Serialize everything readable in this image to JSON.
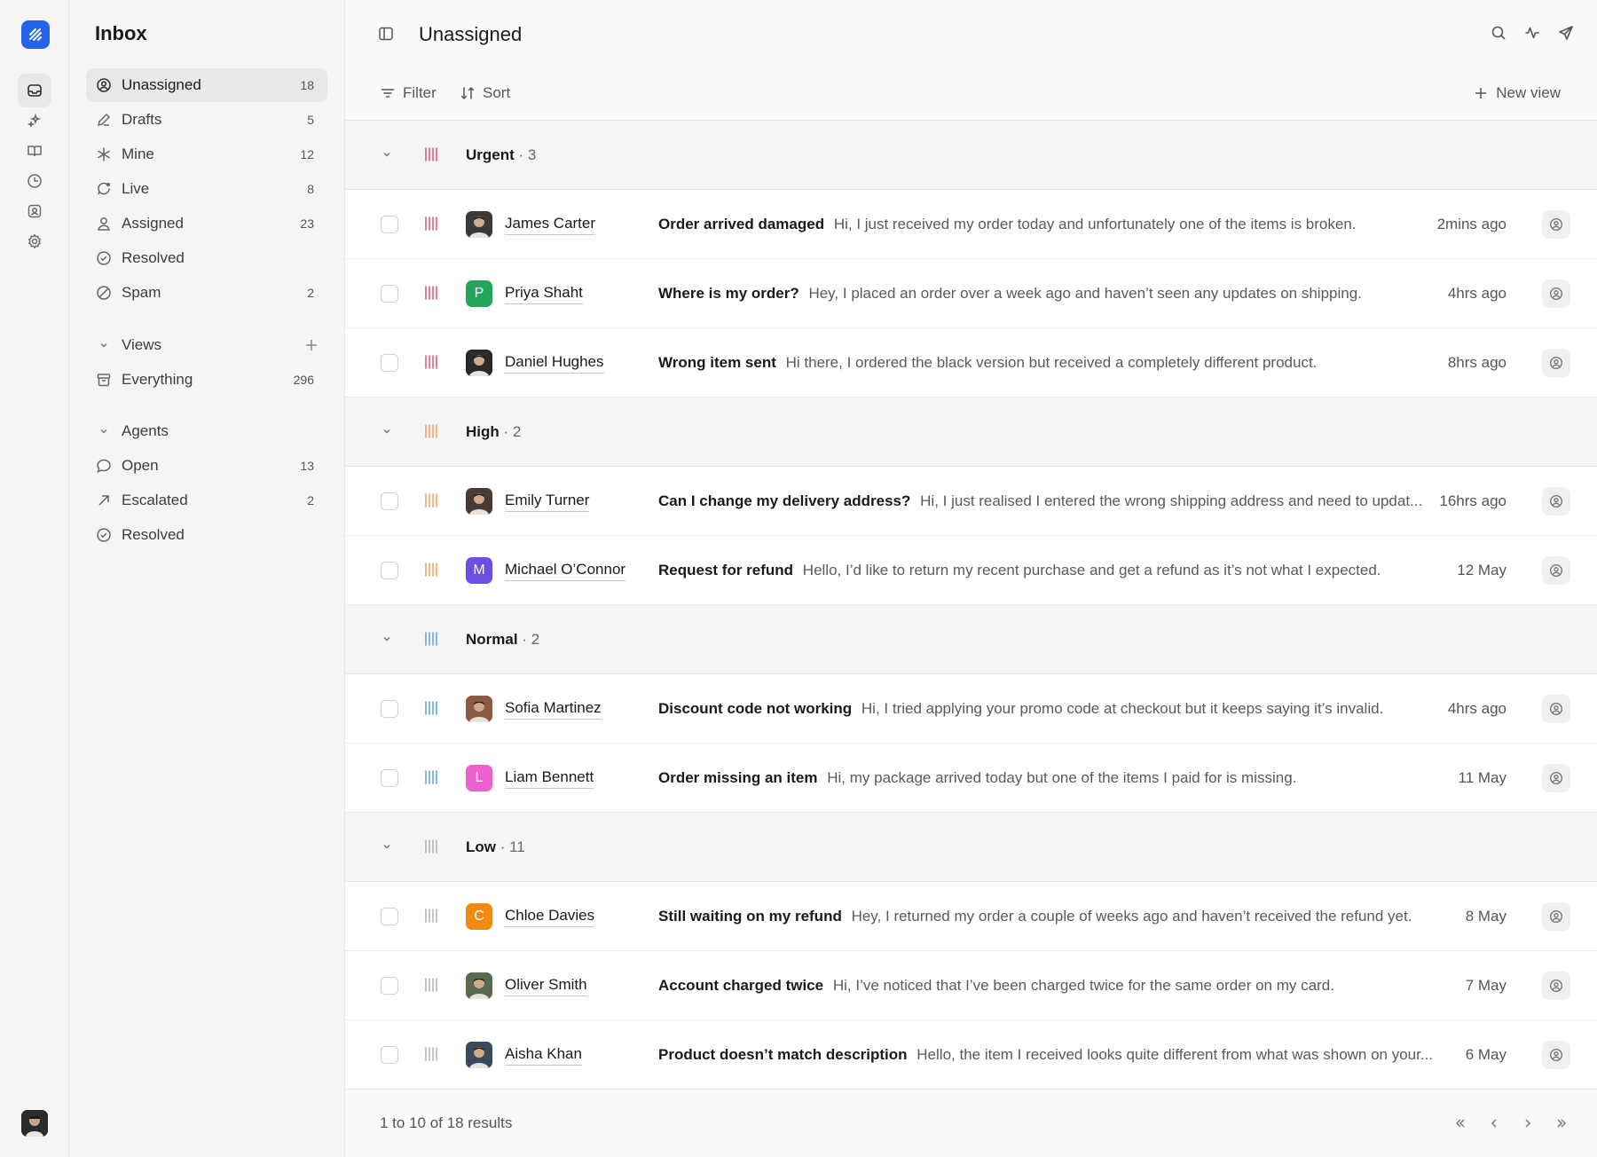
{
  "sidebar": {
    "title": "Inbox",
    "items": [
      {
        "label": "Unassigned",
        "count": "18",
        "icon": "user-circle-icon"
      },
      {
        "label": "Drafts",
        "count": "5",
        "icon": "pencil-icon"
      },
      {
        "label": "Mine",
        "count": "12",
        "icon": "asterisk-icon"
      },
      {
        "label": "Live",
        "count": "8",
        "icon": "live-chat-icon"
      },
      {
        "label": "Assigned",
        "count": "23",
        "icon": "user-icon"
      },
      {
        "label": "Resolved",
        "count": "",
        "icon": "check-circle-icon"
      },
      {
        "label": "Spam",
        "count": "2",
        "icon": "ban-icon"
      }
    ],
    "views": {
      "label": "Views",
      "items": [
        {
          "label": "Everything",
          "count": "296",
          "icon": "archive-icon"
        }
      ]
    },
    "agents": {
      "label": "Agents",
      "items": [
        {
          "label": "Open",
          "count": "13",
          "icon": "chat-bubble-icon"
        },
        {
          "label": "Escalated",
          "count": "2",
          "icon": "arrow-up-right-icon"
        },
        {
          "label": "Resolved",
          "count": "",
          "icon": "check-circle-icon"
        }
      ]
    }
  },
  "header": {
    "title": "Unassigned"
  },
  "toolbar": {
    "filter_label": "Filter",
    "sort_label": "Sort",
    "new_view_label": "New view"
  },
  "colors": {
    "urgent": "#e0556b",
    "high": "#f0a060",
    "normal": "#5aa0e0",
    "low": "#b0b0b0",
    "accent": "#2563eb"
  },
  "groups": [
    {
      "name": "Urgent",
      "count": "3",
      "priority": "urgent",
      "rows": [
        {
          "name": "James Carter",
          "avatar": "photo",
          "avatar_color": "#3a3a3a",
          "subject": "Order arrived damaged",
          "preview": "Hi, I just received my order today and unfortunately one of the items is broken.",
          "time": "2mins ago"
        },
        {
          "name": "Priya Shaht",
          "avatar": "P",
          "avatar_color": "#22a55a",
          "subject": "Where is my order?",
          "preview": "Hey, I placed an order over a week ago and haven’t seen any updates on shipping.",
          "time": "4hrs ago"
        },
        {
          "name": "Daniel Hughes",
          "avatar": "photo",
          "avatar_color": "#2a2a2a",
          "subject": "Wrong item sent",
          "preview": "Hi there, I ordered the black version but received a completely different product.",
          "time": "8hrs ago"
        }
      ]
    },
    {
      "name": "High",
      "count": "2",
      "priority": "high",
      "rows": [
        {
          "name": "Emily Turner",
          "avatar": "photo",
          "avatar_color": "#4a3a35",
          "subject": "Can I change my delivery address?",
          "preview": "Hi, I just realised I entered the wrong shipping address and need to updat...",
          "time": "16hrs ago"
        },
        {
          "name": "Michael O’Connor",
          "avatar": "M",
          "avatar_color": "#6a4fe0",
          "subject": "Request for refund",
          "preview": "Hello, I’d like to return my recent purchase and get a refund as it’s not what I expected.",
          "time": "12 May"
        }
      ]
    },
    {
      "name": "Normal",
      "count": "2",
      "priority": "normal",
      "rows": [
        {
          "name": "Sofia Martinez",
          "avatar": "photo",
          "avatar_color": "#8a5a45",
          "subject": "Discount code not working",
          "preview": "Hi, I tried applying your promo code at checkout but it keeps saying it’s invalid.",
          "time": "4hrs ago"
        },
        {
          "name": "Liam Bennett",
          "avatar": "L",
          "avatar_color": "#ee5fd0",
          "subject": "Order missing an item",
          "preview": "Hi, my package arrived today but one of the items I paid for is missing.",
          "time": "11 May"
        }
      ]
    },
    {
      "name": "Low",
      "count": "11",
      "priority": "low",
      "rows": [
        {
          "name": "Chloe Davies",
          "avatar": "C",
          "avatar_color": "#f08a10",
          "subject": "Still waiting on my refund",
          "preview": "Hey, I returned my order a couple of weeks ago and haven’t received the refund yet.",
          "time": "8 May"
        },
        {
          "name": "Oliver Smith",
          "avatar": "photo",
          "avatar_color": "#5a6a50",
          "subject": "Account charged twice",
          "preview": "Hi, I’ve noticed that I’ve been charged twice for the same order on my card.",
          "time": "7 May"
        },
        {
          "name": "Aisha Khan",
          "avatar": "photo",
          "avatar_color": "#3a4a5a",
          "subject": "Product doesn’t match description",
          "preview": "Hello, the item I received looks quite different from what was shown on your...",
          "time": "6 May"
        }
      ]
    }
  ],
  "footer": {
    "results": "1 to 10 of 18 results"
  }
}
